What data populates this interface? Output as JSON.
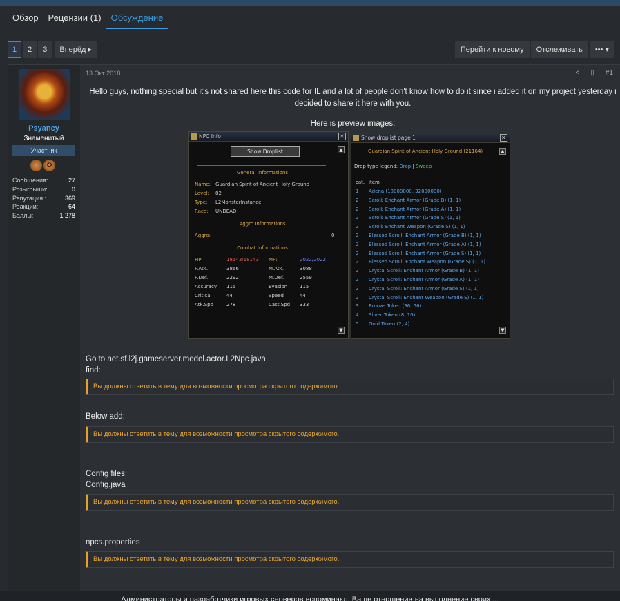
{
  "tabs": [
    "Обзор",
    "Рецензии (1)",
    "Обсуждение"
  ],
  "pager": {
    "pages": [
      "1",
      "2",
      "3"
    ],
    "next": "Вперёд ▸"
  },
  "actions": {
    "goto_new": "Перейти к новому",
    "watch": "Отслеживать",
    "more": "••• ▾"
  },
  "user": {
    "name": "Psyancy",
    "title": "Знаменитый",
    "badge": "Участник",
    "medals": [
      "",
      "✪"
    ],
    "stats": [
      {
        "k": "Сообщения:",
        "v": "27"
      },
      {
        "k": "Розыгрыши:",
        "v": "0"
      },
      {
        "k": "Репутация :",
        "v": "369"
      },
      {
        "k": "Реакции:",
        "v": "64"
      },
      {
        "k": "Баллы:",
        "v": "1 278"
      }
    ]
  },
  "post": {
    "date": "13 Окт 2018",
    "number": "#1",
    "share_icon": "share-icon",
    "bookmark_icon": "bookmark-icon",
    "intro": "Hello guys, nothing special but it's not shared here this code for IL and a lot of people don't know how to do it since i added it on my project yesterday i decided to share it here with you.",
    "preview_label": "Here is preview images:",
    "goto": "Go to net.sf.l2j.gameserver.model.actor.L2Npc.java",
    "find": "find:",
    "below": "Below add:",
    "config_files": "Config files:",
    "config_java": "Config.java",
    "npcs": "npcs.properties",
    "hidden_text": "Вы должны ответить в тему для возможности просмотра скрытого содержимого."
  },
  "npc_info": {
    "title": "NPC Info",
    "button": "Show Droplist",
    "general": "General Informations",
    "rows": [
      {
        "l": "Name:",
        "v": "Guardian Spirit of Ancient Holy Ground"
      },
      {
        "l": "Level:",
        "v": "82"
      },
      {
        "l": "Type:",
        "v": "L2MonsterInstance"
      },
      {
        "l": "Race:",
        "v": "UNDEAD"
      }
    ],
    "aggro_title": "Aggro Informations",
    "aggro_label": "Aggro:",
    "aggro_value": "0",
    "combat": "Combat Informations",
    "hp_l": "HP:",
    "hp_v": "18143/18143",
    "mp_l": "MP:",
    "mp_v": "2022/2022",
    "combat_rows": [
      {
        "l1": "P.Atk.",
        "v1": "3866",
        "l2": "M.Atk.",
        "v2": "3088"
      },
      {
        "l1": "P.Def.",
        "v1": "2292",
        "l2": "M.Def.",
        "v2": "2559"
      },
      {
        "l1": "Accuracy",
        "v1": "115",
        "l2": "Evasion",
        "v2": "115"
      },
      {
        "l1": "Critical",
        "v1": "44",
        "l2": "Speed",
        "v2": "44"
      },
      {
        "l1": "Atk.Spd",
        "v1": "278",
        "l2": "Cast.Spd",
        "v2": "333"
      }
    ]
  },
  "droplist": {
    "title": "Show droplist page 1",
    "header": "Guardian Spirit of Ancient Holy Ground (21164)",
    "legend": "Drop type legend:",
    "drop": "Drop",
    "sep": " | ",
    "sweep": "Sweep",
    "col_cat": "cat.",
    "col_item": "item",
    "rows": [
      {
        "c": "1",
        "i": "Adena (18000000, 32000000)"
      },
      {
        "c": "2",
        "i": "Scroll: Enchant Armor (Grade B) (1, 1)"
      },
      {
        "c": "2",
        "i": "Scroll: Enchant Armor (Grade A) (1, 1)"
      },
      {
        "c": "2",
        "i": "Scroll: Enchant Armor (Grade S) (1, 1)"
      },
      {
        "c": "2",
        "i": "Scroll: Enchant Weapon (Grade S) (1, 1)"
      },
      {
        "c": "2",
        "i": "Blessed Scroll: Enchant Armor (Grade B) (1, 1)"
      },
      {
        "c": "2",
        "i": "Blessed Scroll: Enchant Armor (Grade A) (1, 1)"
      },
      {
        "c": "2",
        "i": "Blessed Scroll: Enchant Armor (Grade S) (1, 1)"
      },
      {
        "c": "2",
        "i": "Blessed Scroll: Enchant Weapon (Grade S) (1, 1)"
      },
      {
        "c": "2",
        "i": "Crystal Scroll: Enchant Armor (Grade B) (1, 1)"
      },
      {
        "c": "2",
        "i": "Crystal Scroll: Enchant Armor (Grade A) (1, 1)"
      },
      {
        "c": "2",
        "i": "Crystal Scroll: Enchant Armor (Grade S) (1, 1)"
      },
      {
        "c": "2",
        "i": "Crystal Scroll: Enchant Weapon (Grade S) (1, 1)"
      },
      {
        "c": "3",
        "i": "Bronze Token (36, 56)"
      },
      {
        "c": "4",
        "i": "Silver Token (8, 16)"
      },
      {
        "c": "5",
        "i": "Gold Token (2, 4)"
      }
    ]
  },
  "footer": "Администраторы и разработчики игровых серверов вспоминают. Ваше отношение на выполнение своих ...",
  "colors": {
    "accent": "#3c9ee0",
    "warning": "#f0a82a",
    "username": "#47a7eb"
  }
}
